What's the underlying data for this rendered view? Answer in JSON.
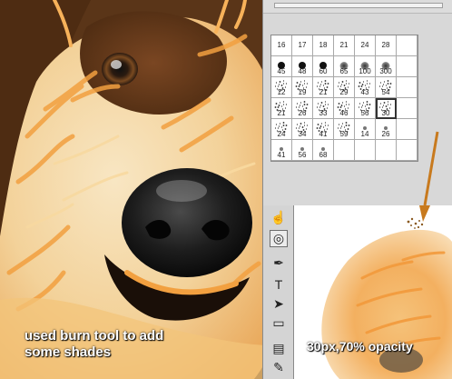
{
  "caption_left": {
    "line1": "used burn tool to add",
    "line2": "some shades"
  },
  "caption_right": "30px,70% opacity",
  "brush_presets": [
    {
      "label": "16",
      "kind": "label"
    },
    {
      "label": "17",
      "kind": "label"
    },
    {
      "label": "18",
      "kind": "label"
    },
    {
      "label": "21",
      "kind": "label"
    },
    {
      "label": "24",
      "kind": "label"
    },
    {
      "label": "28",
      "kind": "label"
    },
    {
      "label": "",
      "kind": "empty"
    },
    {
      "label": "45",
      "kind": "hard"
    },
    {
      "label": "48",
      "kind": "hard"
    },
    {
      "label": "60",
      "kind": "hard"
    },
    {
      "label": "65",
      "kind": "soft"
    },
    {
      "label": "100",
      "kind": "soft"
    },
    {
      "label": "300",
      "kind": "soft"
    },
    {
      "label": "",
      "kind": "empty"
    },
    {
      "label": "12",
      "kind": "spray"
    },
    {
      "label": "19",
      "kind": "spray"
    },
    {
      "label": "21",
      "kind": "spray"
    },
    {
      "label": "29",
      "kind": "spray"
    },
    {
      "label": "43",
      "kind": "spray"
    },
    {
      "label": "54",
      "kind": "spray"
    },
    {
      "label": "",
      "kind": "empty"
    },
    {
      "label": "21",
      "kind": "spray"
    },
    {
      "label": "26",
      "kind": "spray"
    },
    {
      "label": "33",
      "kind": "spray"
    },
    {
      "label": "46",
      "kind": "spray"
    },
    {
      "label": "56",
      "kind": "spray"
    },
    {
      "label": "30",
      "kind": "spray",
      "selected": true
    },
    {
      "label": "",
      "kind": "empty"
    },
    {
      "label": "24",
      "kind": "spray"
    },
    {
      "label": "34",
      "kind": "spray"
    },
    {
      "label": "41",
      "kind": "spray"
    },
    {
      "label": "59",
      "kind": "spray"
    },
    {
      "label": "14",
      "kind": "tiny"
    },
    {
      "label": "26",
      "kind": "tiny"
    },
    {
      "label": "",
      "kind": "empty"
    },
    {
      "label": "41",
      "kind": "tiny"
    },
    {
      "label": "56",
      "kind": "tiny"
    },
    {
      "label": "68",
      "kind": "tiny"
    },
    {
      "label": "",
      "kind": "empty"
    },
    {
      "label": "",
      "kind": "empty"
    },
    {
      "label": "",
      "kind": "empty"
    },
    {
      "label": "",
      "kind": "empty"
    }
  ],
  "tools": [
    {
      "name": "finger-smudge-tool-icon",
      "glyph": "☝"
    },
    {
      "name": "burn-tool-icon",
      "glyph": "◎",
      "active": true
    },
    {
      "name": "pen-tool-icon",
      "glyph": "✒"
    },
    {
      "name": "type-tool-icon",
      "glyph": "T"
    },
    {
      "name": "path-selection-tool-icon",
      "glyph": "➤"
    },
    {
      "name": "rectangle-tool-icon",
      "glyph": "▭"
    },
    {
      "name": "notes-tool-icon",
      "glyph": "▤"
    },
    {
      "name": "eyedropper-tool-icon",
      "glyph": "✎"
    }
  ],
  "colors": {
    "fur_orange": "#f5a34a",
    "fur_cream": "#f7e3b8",
    "background_brown": "#5a3518",
    "arrow": "#c87a1e"
  }
}
